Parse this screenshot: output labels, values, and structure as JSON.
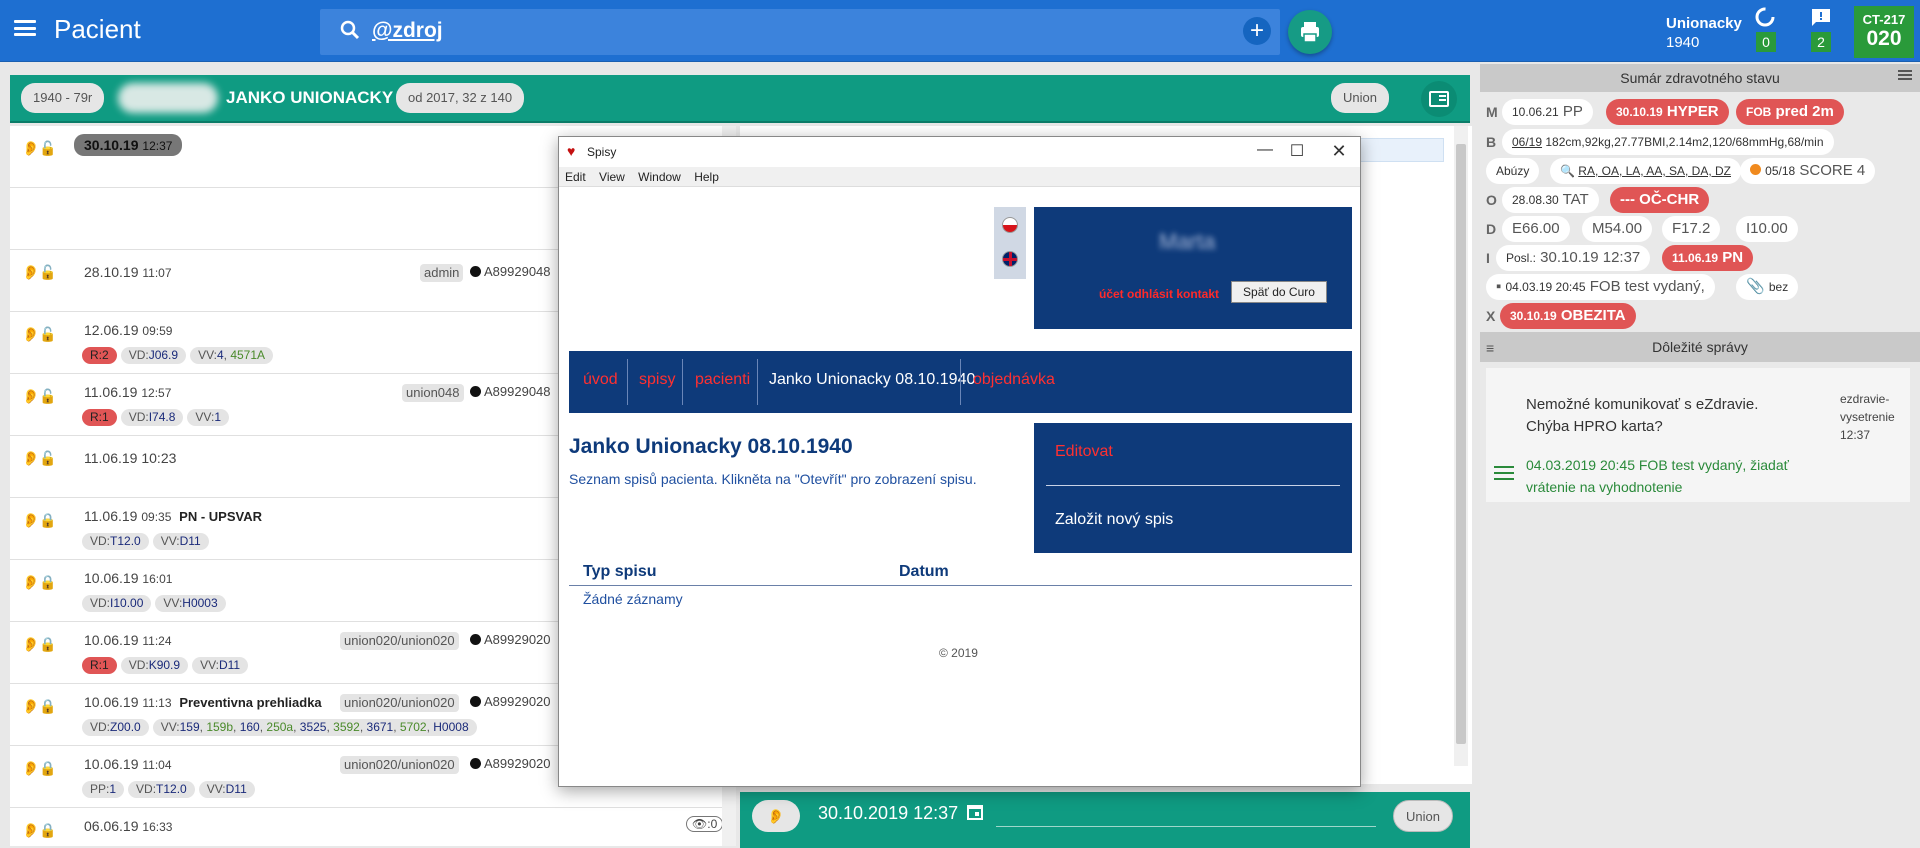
{
  "topbar": {
    "title": "Pacient",
    "search_value": "@zdroj",
    "patient_name": "Unionacky",
    "patient_year": "1940",
    "sync_count": "0",
    "msg_count": "2",
    "ct_label": "CT-217",
    "ct_value": "020"
  },
  "header": {
    "age_pill": "1940 - 79r",
    "name": "JANKO UNIONACKY",
    "since_pill": "od 2017, 32 z 140",
    "org_pill": "Union"
  },
  "timeline": [
    {
      "date": "30.10.19",
      "time": "12:37"
    },
    {
      "date": "28.10.19",
      "time": "11:07",
      "user": "admin",
      "code": "A89929048"
    },
    {
      "date": "12.06.19",
      "time": "09:59"
    },
    {
      "date": "11.06.19",
      "time": "12:57",
      "user": "union048",
      "code": "A89929048"
    },
    {
      "date": "11.06.19",
      "time": "10:23"
    },
    {
      "date": "11.06.19",
      "time": "09:35",
      "label": "PN - UPSVAR"
    },
    {
      "date": "10.06.19",
      "time": "16:01"
    },
    {
      "date": "10.06.19",
      "time": "11:24",
      "user": "union020/union020",
      "code": "A89929020"
    },
    {
      "date": "10.06.19",
      "time": "11:13",
      "label": "Preventivna prehliadka",
      "user": "union020/union020",
      "code": "A89929020"
    },
    {
      "date": "10.06.19",
      "time": "11:04",
      "user": "union020/union020",
      "code": "A89929020"
    },
    {
      "date": "06.06.19",
      "time": "16:33",
      "eye_count": "0"
    }
  ],
  "bottom": {
    "datetime": "30.10.2019 12:37",
    "org": "Union"
  },
  "summary": {
    "title": "Sumár zdravotného stavu",
    "important_title": "Dôležité správy",
    "messages": [
      {
        "text": "Nemožné komunikovať s eZdravie. Chýba HPRO karta?",
        "source": "ezdravie-\nvysetrenie\n12:37"
      },
      {
        "text": "04.03.2019 20:45 FOB test vydaný, žiadať vrátenie na vyhodnotenie"
      }
    ]
  },
  "popup": {
    "title": "Spisy",
    "menu": [
      "Edit",
      "View",
      "Window",
      "Help"
    ],
    "user_blur": "Marta",
    "links": "účet  odhlásit  kontakt",
    "back_btn": "Späť do Curo",
    "nav": [
      "úvod",
      "spisy",
      "pacienti",
      "Janko Unionacky 08.10.1940",
      "objednávka"
    ],
    "heading": "Janko Unionacky 08.10.1940",
    "subtitle": "Seznam spisů pacienta. Klikněta na \"Otevřít\" pro zobrazení spisu.",
    "action_edit": "Editovat",
    "action_new": "Založit nový spis",
    "col_type": "Typ spisu",
    "col_date": "Datum",
    "empty": "Žádné záznamy",
    "copyright": "© 2019"
  },
  "colors": {
    "topbar": "#1e6fd1",
    "teal": "#0f9b82",
    "navy": "#0e3a7a",
    "red": "#e05555",
    "green": "#2a9a3a"
  }
}
